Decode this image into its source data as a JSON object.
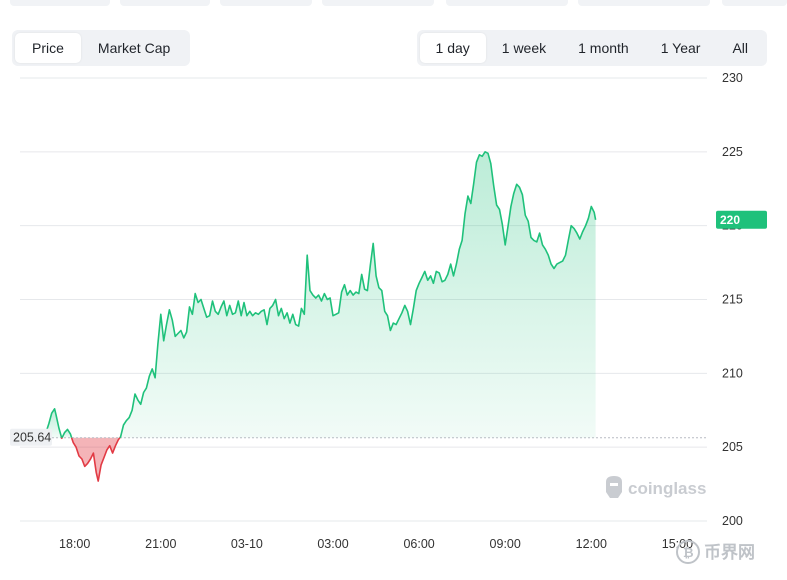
{
  "toolbar": {
    "type_tabs": [
      {
        "label": "Price",
        "active": true
      },
      {
        "label": "Market Cap",
        "active": false
      }
    ],
    "range_tabs": [
      {
        "label": "1 day",
        "active": true
      },
      {
        "label": "1 week",
        "active": false
      },
      {
        "label": "1 month",
        "active": false
      },
      {
        "label": "1 Year",
        "active": false
      },
      {
        "label": "All",
        "active": false
      }
    ]
  },
  "watermarks": {
    "brand": "coinglass",
    "corner": "币界网"
  },
  "colors": {
    "up": "#1fc17b",
    "down": "#e23a44",
    "badge": "#1fc17b"
  },
  "chart_data": {
    "type": "area",
    "baseline": 205.64,
    "baseline_label": "205.64",
    "current_label": "220",
    "current": 220.4,
    "ylim": [
      200,
      230
    ],
    "yticks": [
      "200",
      "205",
      "210",
      "215",
      "220",
      "225",
      "230"
    ],
    "xlim": [
      0,
      23.6
    ],
    "xticks": [
      {
        "label": "18:00",
        "t": 1
      },
      {
        "label": "21:00",
        "t": 4
      },
      {
        "label": "03-10",
        "t": 7
      },
      {
        "label": "03:00",
        "t": 10
      },
      {
        "label": "06:00",
        "t": 13
      },
      {
        "label": "09:00",
        "t": 16
      },
      {
        "label": "12:00",
        "t": 19
      },
      {
        "label": "15:00",
        "t": 22
      }
    ],
    "grid": true,
    "series": [
      {
        "values": [
          [
            0,
            206.0
          ],
          [
            0.1,
            206.6
          ],
          [
            0.2,
            207.3
          ],
          [
            0.3,
            207.6
          ],
          [
            0.35,
            207.2
          ],
          [
            0.45,
            206.3
          ],
          [
            0.55,
            205.6
          ],
          [
            0.65,
            206.0
          ],
          [
            0.75,
            206.2
          ],
          [
            0.85,
            205.9
          ],
          [
            0.95,
            205.3
          ],
          [
            1.05,
            205.0
          ],
          [
            1.15,
            204.4
          ],
          [
            1.25,
            204.2
          ],
          [
            1.35,
            203.7
          ],
          [
            1.45,
            203.9
          ],
          [
            1.55,
            204.2
          ],
          [
            1.65,
            204.6
          ],
          [
            1.75,
            203.3
          ],
          [
            1.82,
            202.7
          ],
          [
            1.92,
            203.8
          ],
          [
            2.02,
            204.3
          ],
          [
            2.12,
            204.8
          ],
          [
            2.22,
            205.1
          ],
          [
            2.32,
            204.6
          ],
          [
            2.42,
            205.1
          ],
          [
            2.52,
            205.5
          ],
          [
            2.6,
            205.7
          ],
          [
            2.7,
            206.5
          ],
          [
            2.8,
            206.8
          ],
          [
            2.9,
            207.0
          ],
          [
            3.0,
            207.5
          ],
          [
            3.1,
            208.6
          ],
          [
            3.2,
            208.2
          ],
          [
            3.3,
            207.9
          ],
          [
            3.4,
            208.7
          ],
          [
            3.5,
            209.0
          ],
          [
            3.6,
            209.8
          ],
          [
            3.7,
            210.3
          ],
          [
            3.8,
            209.7
          ],
          [
            3.9,
            212.0
          ],
          [
            4.0,
            214.0
          ],
          [
            4.1,
            212.2
          ],
          [
            4.2,
            213.3
          ],
          [
            4.3,
            214.3
          ],
          [
            4.4,
            213.6
          ],
          [
            4.5,
            212.5
          ],
          [
            4.6,
            212.7
          ],
          [
            4.7,
            212.9
          ],
          [
            4.8,
            212.4
          ],
          [
            4.9,
            212.8
          ],
          [
            5.0,
            214.5
          ],
          [
            5.1,
            214.0
          ],
          [
            5.2,
            215.4
          ],
          [
            5.3,
            214.8
          ],
          [
            5.4,
            215.0
          ],
          [
            5.5,
            214.4
          ],
          [
            5.6,
            213.8
          ],
          [
            5.7,
            213.9
          ],
          [
            5.8,
            214.9
          ],
          [
            5.9,
            214.2
          ],
          [
            6.0,
            214.0
          ],
          [
            6.1,
            214.5
          ],
          [
            6.2,
            214.9
          ],
          [
            6.3,
            213.9
          ],
          [
            6.4,
            214.6
          ],
          [
            6.5,
            214.0
          ],
          [
            6.6,
            214.1
          ],
          [
            6.7,
            214.9
          ],
          [
            6.8,
            213.9
          ],
          [
            6.9,
            214.8
          ],
          [
            7.0,
            213.9
          ],
          [
            7.1,
            214.2
          ],
          [
            7.2,
            213.9
          ],
          [
            7.3,
            214.1
          ],
          [
            7.4,
            214.0
          ],
          [
            7.5,
            214.2
          ],
          [
            7.6,
            214.3
          ],
          [
            7.7,
            213.3
          ],
          [
            7.8,
            214.4
          ],
          [
            7.9,
            214.6
          ],
          [
            8.0,
            215.0
          ],
          [
            8.1,
            213.9
          ],
          [
            8.2,
            214.4
          ],
          [
            8.3,
            213.7
          ],
          [
            8.4,
            214.1
          ],
          [
            8.5,
            213.4
          ],
          [
            8.6,
            214.0
          ],
          [
            8.7,
            213.3
          ],
          [
            8.8,
            213.2
          ],
          [
            8.9,
            214.4
          ],
          [
            9.0,
            214.0
          ],
          [
            9.1,
            218.0
          ],
          [
            9.2,
            215.6
          ],
          [
            9.3,
            215.3
          ],
          [
            9.4,
            215.1
          ],
          [
            9.5,
            215.3
          ],
          [
            9.6,
            214.9
          ],
          [
            9.7,
            215.4
          ],
          [
            9.8,
            215.0
          ],
          [
            9.9,
            215.1
          ],
          [
            10.0,
            213.9
          ],
          [
            10.1,
            214.0
          ],
          [
            10.2,
            214.1
          ],
          [
            10.3,
            215.5
          ],
          [
            10.4,
            216.0
          ],
          [
            10.5,
            215.3
          ],
          [
            10.6,
            215.6
          ],
          [
            10.7,
            215.3
          ],
          [
            10.8,
            215.5
          ],
          [
            10.9,
            215.4
          ],
          [
            11.0,
            216.7
          ],
          [
            11.1,
            215.7
          ],
          [
            11.2,
            215.6
          ],
          [
            11.3,
            217.3
          ],
          [
            11.4,
            218.8
          ],
          [
            11.5,
            216.6
          ],
          [
            11.6,
            215.8
          ],
          [
            11.7,
            215.6
          ],
          [
            11.8,
            214.2
          ],
          [
            11.9,
            213.9
          ],
          [
            12.0,
            212.9
          ],
          [
            12.1,
            213.4
          ],
          [
            12.2,
            213.3
          ],
          [
            12.3,
            213.7
          ],
          [
            12.4,
            214.1
          ],
          [
            12.5,
            214.6
          ],
          [
            12.6,
            214.2
          ],
          [
            12.7,
            213.3
          ],
          [
            12.8,
            214.4
          ],
          [
            12.9,
            215.6
          ],
          [
            13.0,
            216.1
          ],
          [
            13.1,
            216.5
          ],
          [
            13.2,
            216.9
          ],
          [
            13.3,
            216.3
          ],
          [
            13.4,
            216.6
          ],
          [
            13.5,
            216.1
          ],
          [
            13.6,
            216.9
          ],
          [
            13.7,
            216.8
          ],
          [
            13.8,
            216.2
          ],
          [
            13.9,
            216.3
          ],
          [
            14.0,
            216.7
          ],
          [
            14.1,
            217.4
          ],
          [
            14.2,
            216.6
          ],
          [
            14.3,
            217.4
          ],
          [
            14.4,
            218.4
          ],
          [
            14.5,
            219.0
          ],
          [
            14.6,
            220.8
          ],
          [
            14.7,
            222.0
          ],
          [
            14.8,
            221.5
          ],
          [
            14.9,
            222.8
          ],
          [
            15.0,
            224.3
          ],
          [
            15.1,
            224.8
          ],
          [
            15.2,
            224.7
          ],
          [
            15.3,
            225.0
          ],
          [
            15.4,
            224.9
          ],
          [
            15.5,
            224.2
          ],
          [
            15.6,
            222.7
          ],
          [
            15.7,
            221.4
          ],
          [
            15.8,
            221.1
          ],
          [
            15.9,
            220.1
          ],
          [
            16.0,
            218.7
          ],
          [
            16.1,
            220.0
          ],
          [
            16.2,
            221.3
          ],
          [
            16.3,
            222.2
          ],
          [
            16.4,
            222.8
          ],
          [
            16.5,
            222.6
          ],
          [
            16.6,
            222.1
          ],
          [
            16.7,
            220.7
          ],
          [
            16.8,
            220.3
          ],
          [
            16.9,
            219.2
          ],
          [
            17.0,
            219.0
          ],
          [
            17.1,
            218.9
          ],
          [
            17.2,
            219.5
          ],
          [
            17.3,
            218.7
          ],
          [
            17.4,
            218.4
          ],
          [
            17.5,
            218.0
          ],
          [
            17.6,
            217.4
          ],
          [
            17.7,
            217.1
          ],
          [
            17.8,
            217.4
          ],
          [
            17.9,
            217.5
          ],
          [
            18.0,
            217.6
          ],
          [
            18.1,
            218.0
          ],
          [
            18.2,
            219.0
          ],
          [
            18.3,
            220.0
          ],
          [
            18.4,
            219.8
          ],
          [
            18.5,
            219.5
          ],
          [
            18.6,
            219.1
          ],
          [
            18.7,
            219.6
          ],
          [
            18.8,
            220.0
          ],
          [
            18.9,
            220.5
          ],
          [
            19.0,
            221.3
          ],
          [
            19.1,
            220.9
          ],
          [
            19.15,
            220.4
          ]
        ]
      }
    ]
  }
}
